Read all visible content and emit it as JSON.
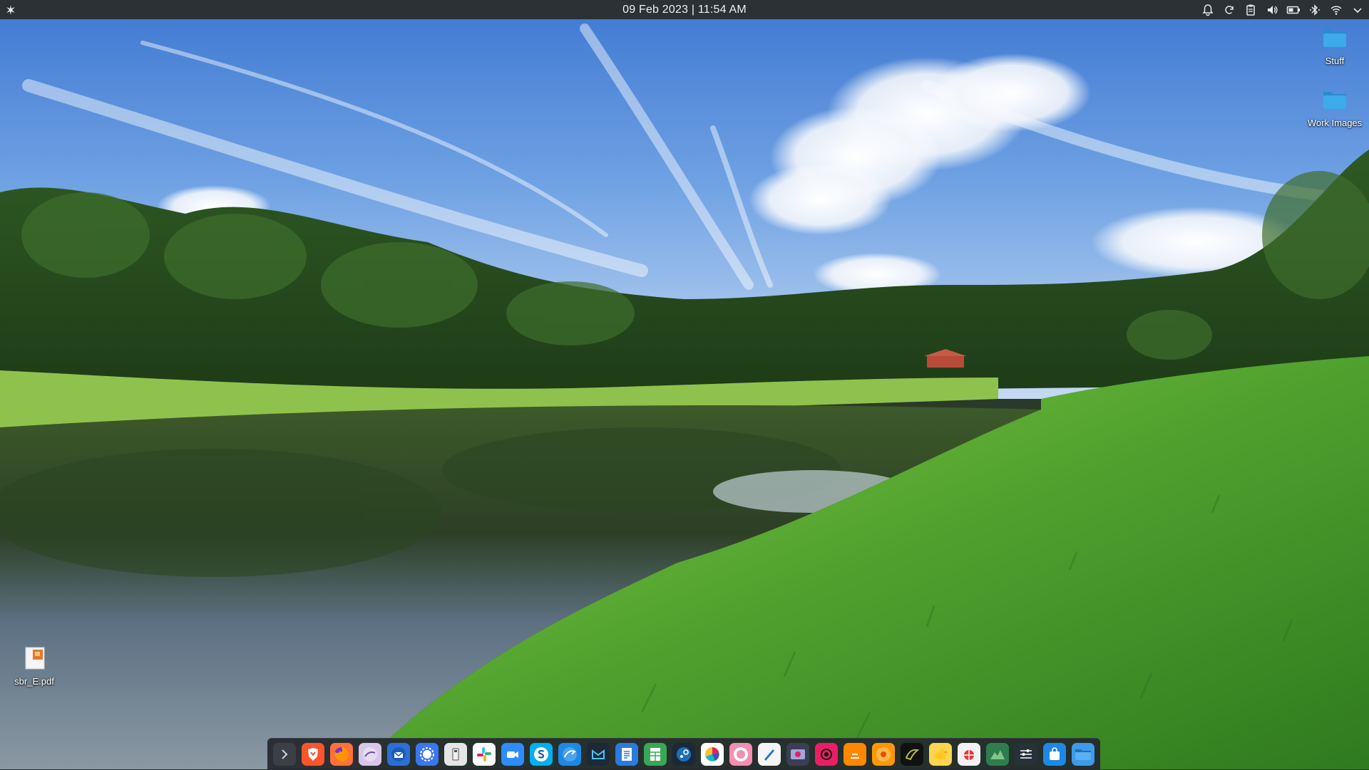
{
  "top_panel": {
    "clock": "09 Feb 2023 | 11:54 AM"
  },
  "desktop": {
    "icons": [
      {
        "label": "Stuff",
        "icon": "folder-icon"
      },
      {
        "label": "Work Images",
        "icon": "folder-icon"
      },
      {
        "label": "sbr_E.pdf",
        "icon": "pdf-file-icon"
      }
    ]
  },
  "tray": {
    "icons": [
      "notifications-icon",
      "sync-icon",
      "clipboard-icon",
      "volume-icon",
      "battery-icon",
      "bluetooth-icon",
      "wifi-icon",
      "chevron-down-icon"
    ]
  },
  "dock": {
    "apps": [
      {
        "icon": "terminal-icon",
        "color": "#3b4047"
      },
      {
        "icon": "brave-browser-icon",
        "color": "#fb542b"
      },
      {
        "icon": "firefox-icon",
        "color": "#ff7139"
      },
      {
        "icon": "epiphany-browser-icon",
        "color": "#d8c6e8"
      },
      {
        "icon": "thunderbird-icon",
        "color": "#2d6fd6"
      },
      {
        "icon": "signal-icon",
        "color": "#3a76f0"
      },
      {
        "icon": "usb-flasher-icon",
        "color": "#e5e5e5"
      },
      {
        "icon": "slack-icon",
        "color": "#ffffff"
      },
      {
        "icon": "zoom-icon",
        "color": "#2d8cff"
      },
      {
        "icon": "skype-icon",
        "color": "#00aff0"
      },
      {
        "icon": "chromium-like-icon",
        "color": "#1e88e5"
      },
      {
        "icon": "mail-icon",
        "color": "#1b2a38"
      },
      {
        "icon": "writer-document-icon",
        "color": "#2a7bde"
      },
      {
        "icon": "spreadsheet-icon",
        "color": "#3aa757"
      },
      {
        "icon": "steam-icon",
        "color": "#1b2838"
      },
      {
        "icon": "color-wheel-icon",
        "color": "#ffffff"
      },
      {
        "icon": "avatar-app-icon",
        "color": "#f48fb1"
      },
      {
        "icon": "drawing-icon",
        "color": "#f5f5f5"
      },
      {
        "icon": "screenshot-icon",
        "color": "#3a3f55"
      },
      {
        "icon": "recorder-icon",
        "color": "#e91e63"
      },
      {
        "icon": "vlc-icon",
        "color": "#ff8800"
      },
      {
        "icon": "music-player-icon",
        "color": "#ff9800"
      },
      {
        "icon": "inkscape-icon",
        "color": "#111111"
      },
      {
        "icon": "duck-app-icon",
        "color": "#ffd54f"
      },
      {
        "icon": "bug-tracker-icon",
        "color": "#f2f2f2"
      },
      {
        "icon": "system-monitor-icon",
        "color": "#2e7d4f"
      },
      {
        "icon": "settings-sliders-icon",
        "color": "#263238"
      },
      {
        "icon": "software-store-icon",
        "color": "#1e88e5"
      },
      {
        "icon": "file-manager-icon",
        "color": "#3d9be9"
      }
    ]
  },
  "colors": {
    "panel": "#2c3136",
    "folder": "#3da8e8",
    "sky_top": "#3f7fd6",
    "grass": "#5fb83a",
    "water": "#2e3d2c"
  }
}
